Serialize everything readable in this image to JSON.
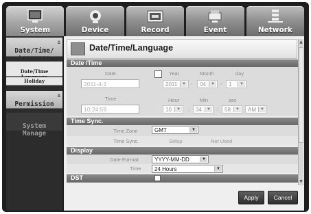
{
  "nav": {
    "tabs": [
      {
        "label": "System",
        "icon": "monitor-icon"
      },
      {
        "label": "Device",
        "icon": "camera-icon"
      },
      {
        "label": "Record",
        "icon": "record-icon"
      },
      {
        "label": "Event",
        "icon": "alarm-icon"
      },
      {
        "label": "Network",
        "icon": "network-icon"
      }
    ],
    "active": "System"
  },
  "sidebar": {
    "date_time_language": "Date/Time/\nLanguage",
    "sub_date_time_language": "Date/Time\nLanguage",
    "sub_holiday": "Holiday",
    "permission_manage": "Permission\nManage",
    "system_manage": "System\nManage"
  },
  "page": {
    "title": "Date/Time/Language"
  },
  "date_time": {
    "section_title": "Date /Time",
    "date_label": "Date",
    "date_value": "2011-4-1",
    "year_label": "Year",
    "month_label": "Month",
    "day_label": "day",
    "year_value": "2011",
    "month_value": "04",
    "day_value": "1",
    "time_label": "Time",
    "time_value": "10:24:59",
    "hour_label": "Hour",
    "min_label": "Min",
    "sec_label": "sec",
    "hour_value": "10",
    "min_value": "34",
    "sec_value": "58",
    "ampm_value": "AM"
  },
  "time_sync": {
    "section_title": "Time Sync.",
    "time_zone_label": "Time Zone",
    "time_zone_value": "GMT",
    "time_sync_label": "Time Sync.",
    "setup_label": "Setup",
    "not_used_label": "Not Used"
  },
  "display": {
    "section_title": "Display",
    "date_format_label": "Date Format",
    "date_format_value": "YYYY-MM-DD",
    "time_label": "Time",
    "time_value": "24 Hours"
  },
  "dst": {
    "section_title": "DST"
  },
  "buttons": {
    "apply": "Apply",
    "cancel": "Cancel"
  }
}
